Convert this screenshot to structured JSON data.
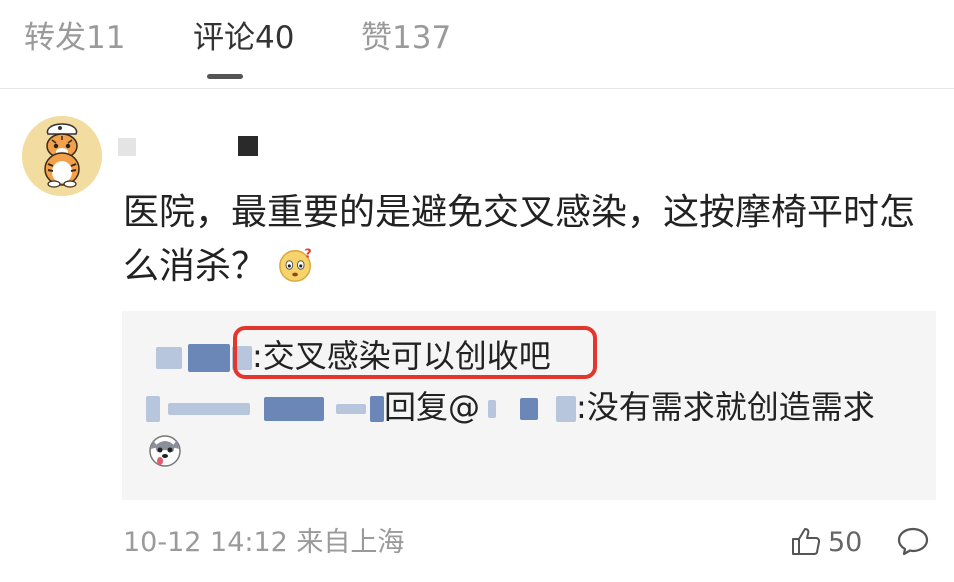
{
  "tabs": [
    {
      "label": "转发11"
    },
    {
      "label": "评论40"
    },
    {
      "label": "赞137"
    }
  ],
  "comment": {
    "text": "医院，最重要的是避免交叉感染，这按摩椅平时怎么消杀？",
    "emoji": "thinking-face-icon",
    "timestamp": "10-12 14:12 来自上海",
    "like_count": "50"
  },
  "replies": [
    {
      "text": ":交叉感染可以创收吧",
      "highlighted": true
    },
    {
      "reply_label": "回复@",
      "text": ":没有需求就创造需求"
    }
  ],
  "colors": {
    "highlight_frame": "#e2362e",
    "reply_bg": "#f5f5f5"
  }
}
